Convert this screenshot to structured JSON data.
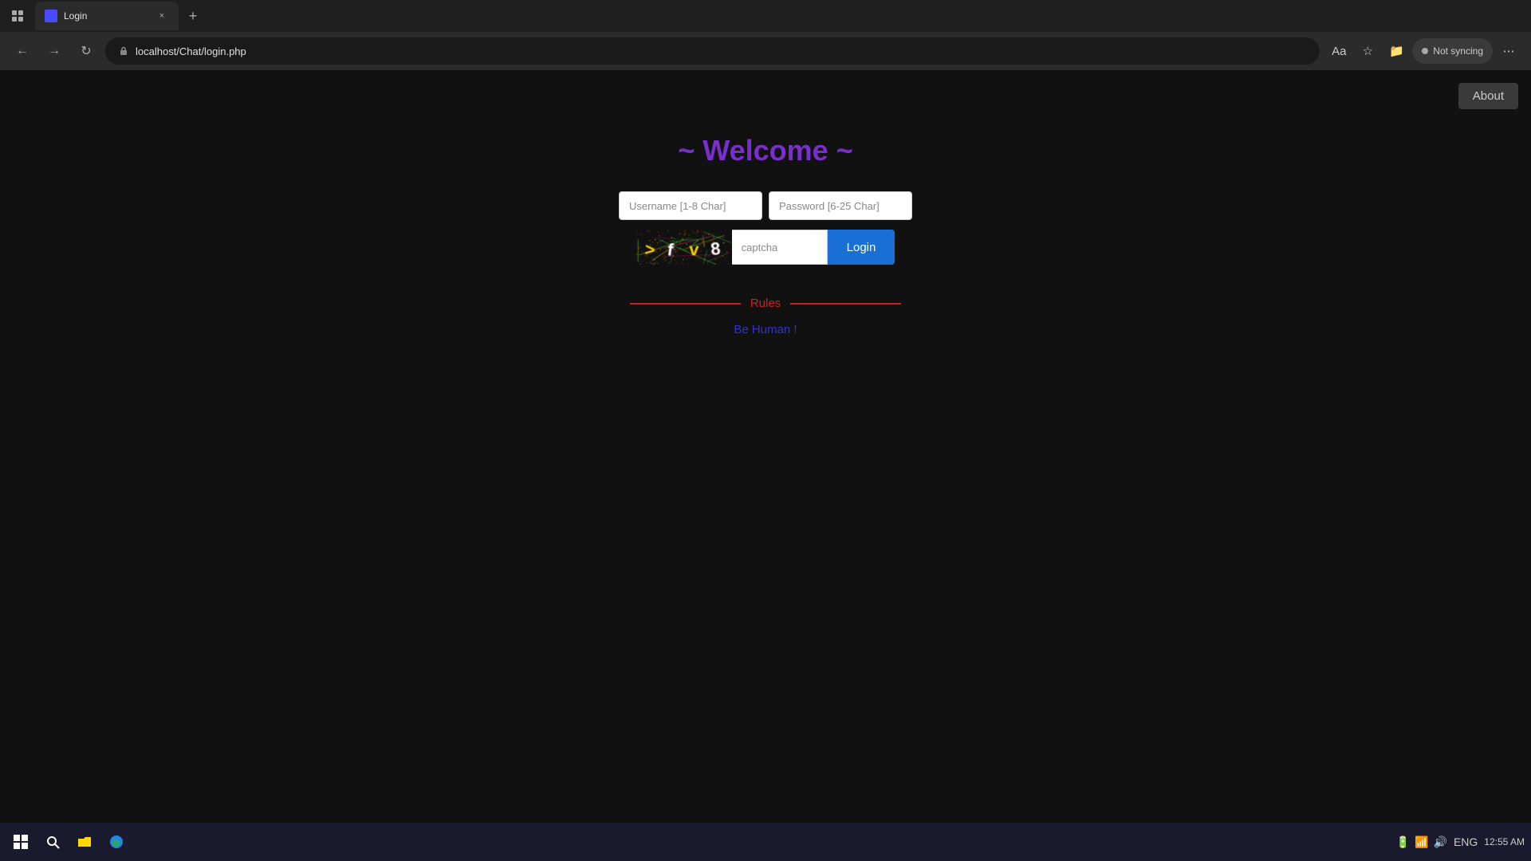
{
  "browser": {
    "tab": {
      "favicon": "🔵",
      "title": "Login",
      "close_label": "×"
    },
    "new_tab_label": "+",
    "nav": {
      "back_label": "←",
      "forward_label": "→",
      "refresh_label": "↻"
    },
    "address": {
      "url": "localhost/Chat/login.php"
    },
    "toolbar_icons": {
      "reader_label": "Aa",
      "favorites_label": "☆",
      "collection_label": "📁",
      "more_label": "⋯"
    },
    "sync": {
      "label": "Not syncing"
    }
  },
  "about_button": {
    "label": "About"
  },
  "page": {
    "welcome_title": "~ Welcome ~",
    "username_placeholder": "Username [1-8 Char]",
    "password_placeholder": "Password [6-25 Char]",
    "captcha_placeholder": "captcha",
    "login_button": "Login",
    "rules_label": "Rules",
    "rules_text": "Be Human !"
  },
  "taskbar": {
    "start_icon": "⊞",
    "search_icon": "⊡",
    "explorer_icon": "📁",
    "edge_icon": "🌐",
    "language": "ENG",
    "time": "12:55 AM"
  }
}
